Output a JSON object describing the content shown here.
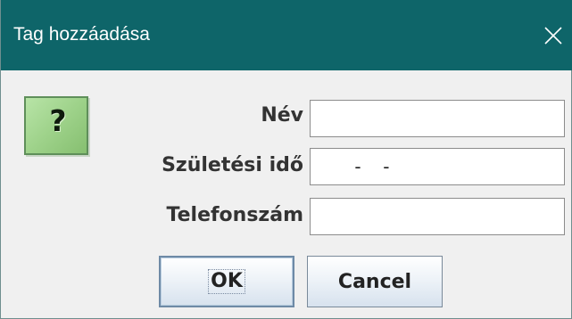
{
  "window": {
    "title": "Tag hozzáadása",
    "close_icon": "close-icon",
    "titlebar_color": "#0e6569"
  },
  "dialog": {
    "icon": "question-icon",
    "icon_glyph": "?",
    "fields": {
      "name": {
        "label": "Név",
        "value": ""
      },
      "birth": {
        "label": "Születési idő",
        "value": "",
        "mask": " -  -"
      },
      "phone": {
        "label": "Telefonszám",
        "value": ""
      }
    }
  },
  "buttons": {
    "ok_label": "OK",
    "cancel_label": "Cancel"
  }
}
